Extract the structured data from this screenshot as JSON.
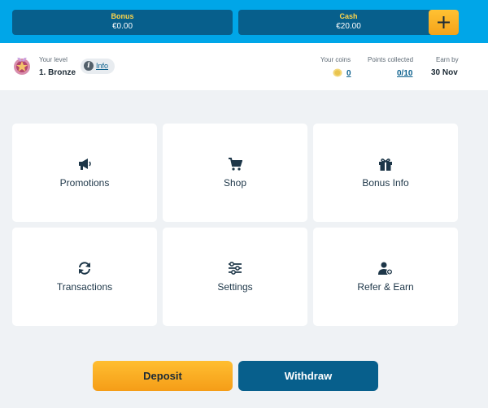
{
  "balances": {
    "bonus": {
      "label": "Bonus",
      "value": "€0.00"
    },
    "cash": {
      "label": "Cash",
      "value": "€20.00"
    },
    "add_icon": "plus-icon"
  },
  "level": {
    "label": "Your level",
    "name": "1. Bronze",
    "info_label": "Info",
    "icon": "bronze-medal-icon"
  },
  "stats": {
    "coins": {
      "label": "Your coins",
      "value": "0",
      "icon": "coin-icon"
    },
    "points": {
      "label": "Points collected",
      "value": "0/10"
    },
    "earn_by": {
      "label": "Earn by",
      "value": "30 Nov"
    }
  },
  "tiles": [
    {
      "label": "Promotions",
      "icon": "megaphone-icon"
    },
    {
      "label": "Shop",
      "icon": "cart-icon"
    },
    {
      "label": "Bonus Info",
      "icon": "gift-icon"
    },
    {
      "label": "Transactions",
      "icon": "refresh-icon"
    },
    {
      "label": "Settings",
      "icon": "sliders-icon"
    },
    {
      "label": "Refer & Earn",
      "icon": "user-plus-icon"
    }
  ],
  "actions": {
    "deposit_label": "Deposit",
    "withdraw_label": "Withdraw"
  },
  "colors": {
    "accent_blue": "#00a6e8",
    "dark_blue": "#075f8c",
    "orange": "#f5a319"
  }
}
